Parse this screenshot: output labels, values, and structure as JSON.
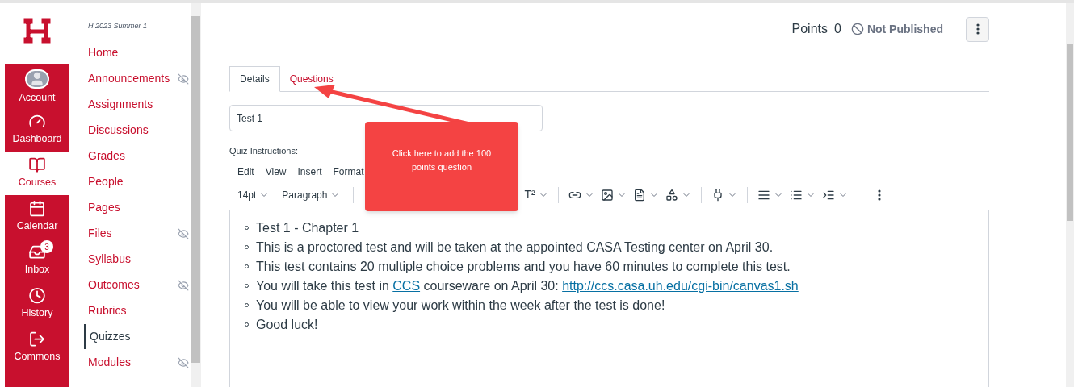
{
  "global_nav": [
    {
      "kind": "account",
      "label": "Account",
      "selected": false
    },
    {
      "kind": "dashboard",
      "label": "Dashboard",
      "selected": false
    },
    {
      "kind": "courses",
      "label": "Courses",
      "selected": true
    },
    {
      "kind": "calendar",
      "label": "Calendar",
      "selected": false
    },
    {
      "kind": "inbox",
      "label": "Inbox",
      "selected": false,
      "badge": "3"
    },
    {
      "kind": "history",
      "label": "History",
      "selected": false
    },
    {
      "kind": "commons",
      "label": "Commons",
      "selected": false
    }
  ],
  "course_nav": {
    "term": "H 2023 Summer 1",
    "items": [
      {
        "label": "Home",
        "selected": false,
        "hidden": false
      },
      {
        "label": "Announcements",
        "selected": false,
        "hidden": true
      },
      {
        "label": "Assignments",
        "selected": false,
        "hidden": false
      },
      {
        "label": "Discussions",
        "selected": false,
        "hidden": false
      },
      {
        "label": "Grades",
        "selected": false,
        "hidden": false
      },
      {
        "label": "People",
        "selected": false,
        "hidden": false
      },
      {
        "label": "Pages",
        "selected": false,
        "hidden": false
      },
      {
        "label": "Files",
        "selected": false,
        "hidden": true
      },
      {
        "label": "Syllabus",
        "selected": false,
        "hidden": false
      },
      {
        "label": "Outcomes",
        "selected": false,
        "hidden": true
      },
      {
        "label": "Rubrics",
        "selected": false,
        "hidden": false
      },
      {
        "label": "Quizzes",
        "selected": true,
        "hidden": false
      },
      {
        "label": "Modules",
        "selected": false,
        "hidden": true
      }
    ]
  },
  "header": {
    "points_label": "Points",
    "points": "0",
    "status": "Not Published"
  },
  "tabs": [
    {
      "label": "Details",
      "selected": true
    },
    {
      "label": "Questions",
      "selected": false
    }
  ],
  "title_field": {
    "value": "Test 1"
  },
  "instructions_label": "Quiz Instructions:",
  "menubar": [
    "Edit",
    "View",
    "Insert",
    "Format"
  ],
  "toolbar": {
    "font_size": "14pt",
    "block": "Paragraph",
    "superscript": "T²"
  },
  "content": [
    [
      {
        "kind": "text",
        "text": "Test 1 - Chapter 1"
      }
    ],
    [
      {
        "kind": "text",
        "text": "This is a proctored test and will be taken at the appointed CASA Testing center on April 30."
      }
    ],
    [
      {
        "kind": "text",
        "text": "This test contains 20 multiple choice problems and you have 60 minutes to complete this test."
      }
    ],
    [
      {
        "kind": "text",
        "text": "You will take this test in "
      },
      {
        "kind": "link",
        "text": "CCS"
      },
      {
        "kind": "text",
        "text": " courseware on April 30: "
      },
      {
        "kind": "link",
        "text": "http://ccs.casa.uh.edu/cgi-bin/canvas1.sh"
      }
    ],
    [
      {
        "kind": "text",
        "text": "You will be able to view your work within the week after the test is done!"
      }
    ],
    [
      {
        "kind": "text",
        "text": "Good luck!"
      }
    ]
  ],
  "callout": {
    "text": "Click here to add the 100 points question"
  }
}
